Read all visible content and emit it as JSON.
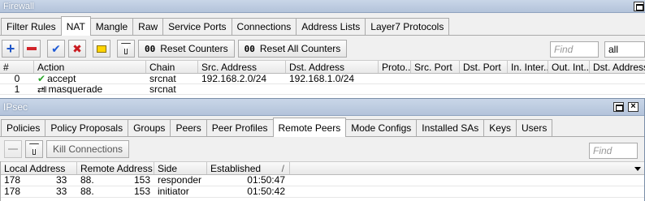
{
  "firewall": {
    "title": "Firewall",
    "tabs": [
      "Filter Rules",
      "NAT",
      "Mangle",
      "Raw",
      "Service Ports",
      "Connections",
      "Address Lists",
      "Layer7 Protocols"
    ],
    "active_tab": "NAT",
    "toolbar": {
      "reset_counters": "Reset Counters",
      "reset_all_counters": "Reset All Counters",
      "find_placeholder": "Find",
      "filter_select": "all"
    },
    "columns": [
      "#",
      "Action",
      "Chain",
      "Src. Address",
      "Dst. Address",
      "Proto...",
      "Src. Port",
      "Dst. Port",
      "In. Inter...",
      "Out. Int...",
      "Dst. Address"
    ],
    "rows": [
      {
        "num": "0",
        "action": "accept",
        "chain": "srcnat",
        "src": "192.168.2.0/24",
        "dst": "192.168.1.0/24"
      },
      {
        "num": "1",
        "action": "masquerade",
        "chain": "srcnat",
        "src": "",
        "dst": ""
      }
    ]
  },
  "ipsec": {
    "title": "IPsec",
    "tabs": [
      "Policies",
      "Policy Proposals",
      "Groups",
      "Peers",
      "Peer Profiles",
      "Remote Peers",
      "Mode Configs",
      "Installed SAs",
      "Keys",
      "Users"
    ],
    "active_tab": "Remote Peers",
    "toolbar": {
      "kill_connections": "Kill Connections",
      "find_placeholder": "Find"
    },
    "columns": [
      "Local Address",
      "Remote Address",
      "Side",
      "Established",
      "/"
    ],
    "rows": [
      {
        "local": "178",
        "local2": "33",
        "remote": "88.",
        "remote2": "153",
        "side": "responder",
        "established": "01:50:47"
      },
      {
        "local": "178",
        "local2": "33",
        "remote": "88.",
        "remote2": "153",
        "side": "initiator",
        "established": "01:50:42"
      }
    ]
  }
}
